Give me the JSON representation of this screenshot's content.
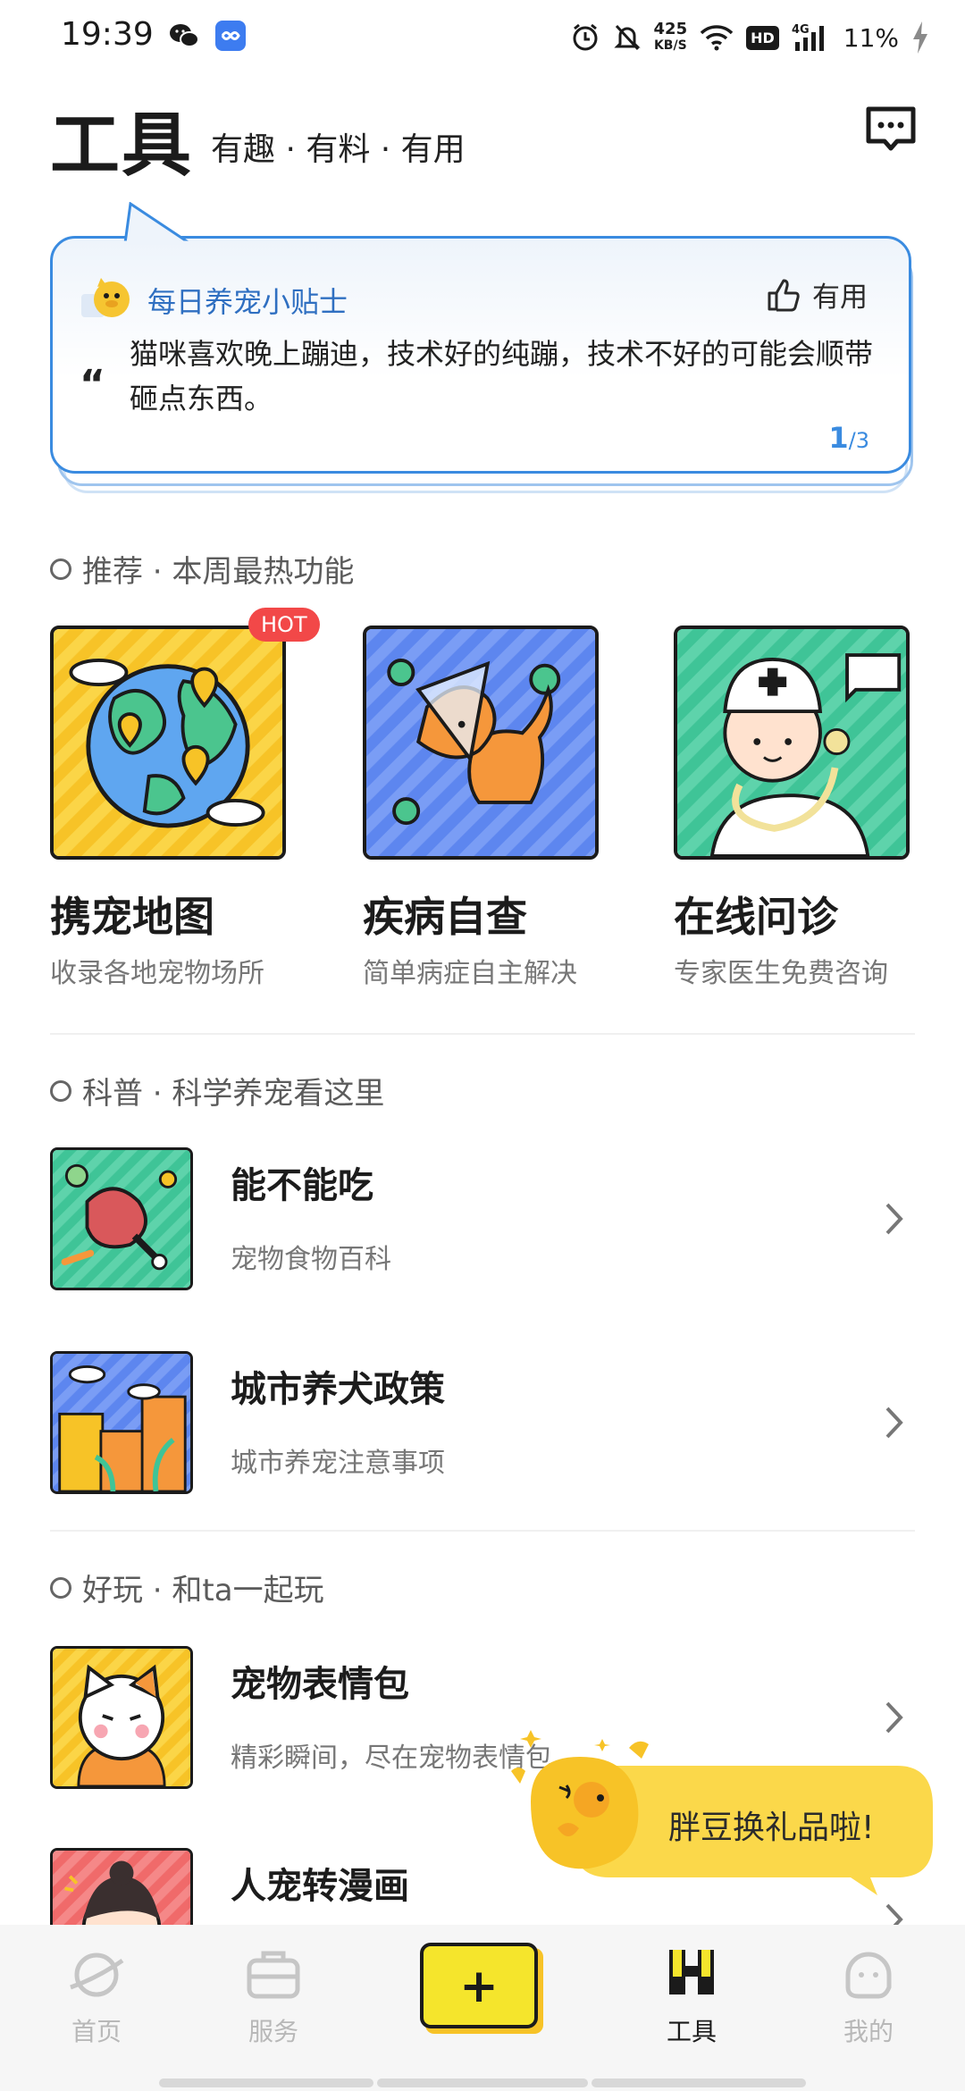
{
  "status_bar": {
    "time": "19:39",
    "network_speed_value": "425",
    "network_speed_unit": "KB/S",
    "hd_badge": "HD",
    "signal_label": "4G",
    "battery": "11%"
  },
  "header": {
    "title": "工具",
    "subtitle": "有趣 · 有料 · 有用"
  },
  "tip_card": {
    "title": "每日养宠小贴士",
    "useful_label": "有用",
    "quote_mark": "“",
    "text": "猫咪喜欢晚上蹦迪，技术好的纯蹦，技术不好的可能会顺带砸点东西。",
    "page_current": "1",
    "page_total": "/3"
  },
  "sections": {
    "recommend": "推荐 · 本周最热功能",
    "science": "科普 · 科学养宠看这里",
    "fun": "好玩 · 和ta一起玩"
  },
  "recommend_items": [
    {
      "name": "携宠地图",
      "desc": "收录各地宠物场所",
      "badge": "HOT"
    },
    {
      "name": "疾病自查",
      "desc": "简单病症自主解决"
    },
    {
      "name": "在线问诊",
      "desc": "专家医生免费咨询"
    }
  ],
  "science_items": [
    {
      "title": "能不能吃",
      "sub": "宠物食物百科"
    },
    {
      "title": "城市养犬政策",
      "sub": "城市养宠注意事项"
    }
  ],
  "fun_items": [
    {
      "title": "宠物表情包",
      "sub": "精彩瞬间，尽在宠物表情包"
    },
    {
      "title": "人宠转漫画",
      "sub": ""
    }
  ],
  "promo": {
    "text": "胖豆换礼品啦!"
  },
  "bottom_nav": [
    {
      "label": "首页",
      "active": false
    },
    {
      "label": "服务",
      "active": false
    },
    {
      "label": "+",
      "active": false
    },
    {
      "label": "工具",
      "active": true
    },
    {
      "label": "我的",
      "active": false
    }
  ],
  "colors": {
    "accent_blue": "#3a8be0",
    "hot_red": "#f24848",
    "brand_yellow": "#f7d731"
  }
}
